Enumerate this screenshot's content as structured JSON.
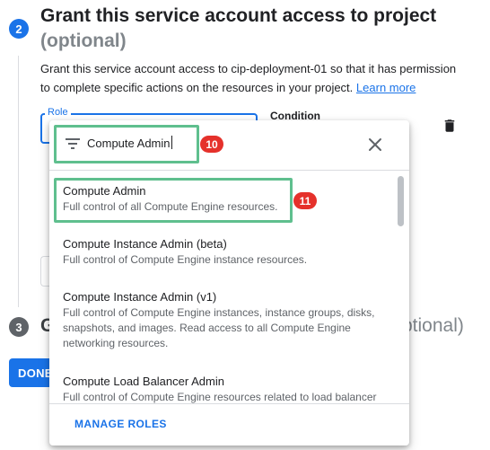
{
  "step2": {
    "number": "2",
    "title": "Grant this service account access to project",
    "subtitle": "(optional)",
    "description_line1": "Grant this service account access to cip-deployment-01 so that it has permission",
    "description_line2": "to complete specific actions on the resources in your project.",
    "learn_more": "Learn more"
  },
  "form": {
    "role_label": "Role",
    "condition_label": "Condition",
    "delete_icon": "trash-icon"
  },
  "step3": {
    "number": "3",
    "title_visible_start": "G",
    "title_visible_end": "ptional)"
  },
  "actions": {
    "done_label": "DONE"
  },
  "dropdown": {
    "filter_icon": "filter-icon",
    "filter_value": "Compute Admin",
    "close_icon": "close-icon",
    "items": [
      {
        "title": "Compute Admin",
        "description": "Full control of all Compute Engine resources."
      },
      {
        "title": "Compute Instance Admin (beta)",
        "description": "Full control of Compute Engine instance resources."
      },
      {
        "title": "Compute Instance Admin (v1)",
        "description": "Full control of Compute Engine instances, instance groups, disks, snapshots, and images. Read access to all Compute Engine networking resources."
      },
      {
        "title": "Compute Load Balancer Admin",
        "description": "Full control of Compute Engine resources related to load balancer"
      }
    ],
    "manage_roles": "MANAGE ROLES"
  },
  "annotations": {
    "badge_1": "10",
    "badge_2": "11",
    "highlight_color": "#5fbf8e",
    "badge_color": "#e5312b"
  },
  "colors": {
    "accent": "#1a73e8",
    "text": "#202124",
    "secondary_text": "#5f6368"
  }
}
